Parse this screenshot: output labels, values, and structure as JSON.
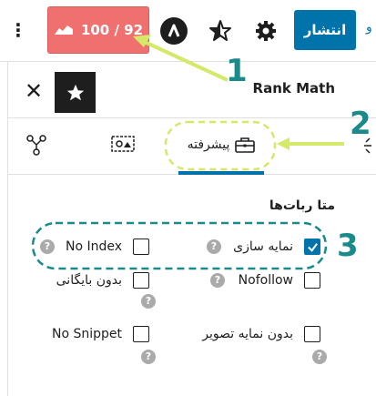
{
  "toolbar": {
    "more_icon": "⋮",
    "seo_score": "100 / 92",
    "publish_label": "انتشار",
    "cut_char": "و"
  },
  "panel": {
    "title": "Rank Math",
    "close_icon": "✕"
  },
  "tabs": [
    {
      "name": "schema",
      "label": ""
    },
    {
      "name": "social",
      "label": ""
    },
    {
      "name": "advanced",
      "label": "پیشرفته",
      "active": true
    }
  ],
  "robots": {
    "section_title": "متا ربات‌ها",
    "options": [
      {
        "label": "نمایه سازی",
        "checked": true
      },
      {
        "label": "No Index",
        "checked": false
      },
      {
        "label": "Nofollow",
        "checked": false
      },
      {
        "label": "بدون بایگانی",
        "checked": false
      },
      {
        "label": "بدون نمایه تصویر",
        "checked": false
      },
      {
        "label": "No Snippet",
        "checked": false
      }
    ],
    "help_glyph": "?"
  },
  "annotations": [
    "1",
    "2",
    "3"
  ],
  "colors": {
    "accent": "#0073aa",
    "score_bg": "#f07070",
    "annotation_teal": "#1b8a8a",
    "arrow_green": "#d4e86a"
  }
}
